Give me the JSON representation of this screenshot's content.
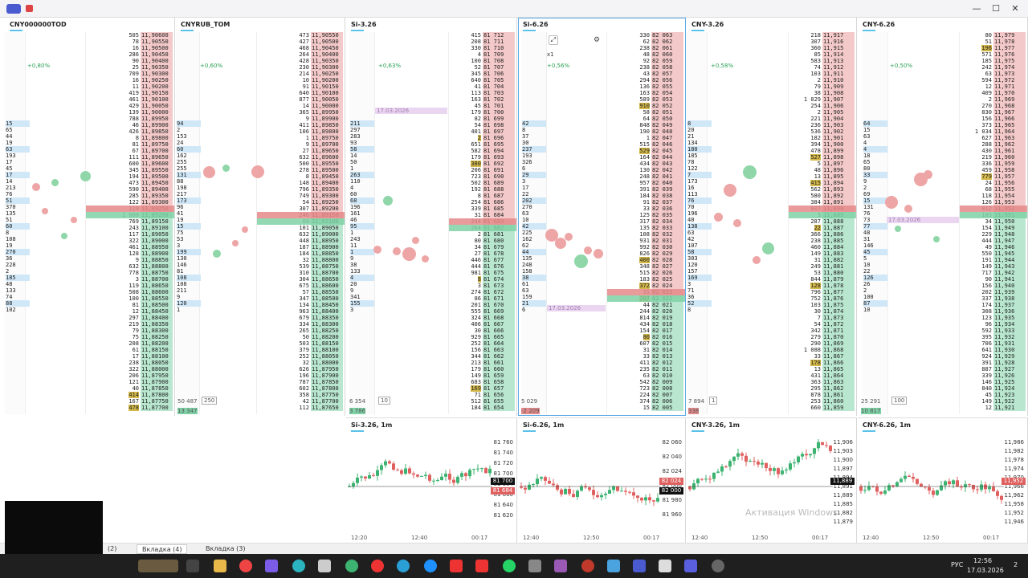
{
  "titlebar": {
    "minimize": "—",
    "maximize": "☐",
    "close": "✕"
  },
  "panels": [
    {
      "name": "CNY000000TOD",
      "pct": "+0,80%",
      "first_price": "11,90600",
      "footer_left": "",
      "footer_right": ""
    },
    {
      "name": "CNYRUB_TOM",
      "pct": "+0,60%",
      "first_price": "11,90550",
      "footer_left": "50 487",
      "footer_left2": "13 347",
      "footer_badge": "250",
      "time": "12:55"
    },
    {
      "name": "Si-3.26",
      "pct": "+0,63%",
      "first_price": "81 712",
      "footer_left": "6 354",
      "footer_left2": "3 786",
      "footer_badge": "10",
      "time": "12:55",
      "date_tag": "17.03.2026"
    },
    {
      "name": "Si-6.26",
      "pct": "+0,56%",
      "first_price": "82 063",
      "footer_left": "5 029",
      "footer_left2": "-2 209",
      "time": "12:55",
      "date_tag": "17.03.2026",
      "zoom": "x1"
    },
    {
      "name": "CNY-3.26",
      "pct": "+0,58%",
      "first_price": "11,917",
      "footer_left": "7 894",
      "footer_left2": "338",
      "footer_badge": "1",
      "time": "12:55"
    },
    {
      "name": "CNY-6.26",
      "pct": "+0,50%",
      "first_price": "11,979",
      "footer_left": "25 291",
      "footer_left2": "10 817",
      "footer_badge": "100",
      "time": "12:55",
      "date_tag": "17.03.2026"
    }
  ],
  "charts": [
    {
      "title": "Si-3.26, 1m",
      "prices": [
        "81 760",
        "81 740",
        "81 720",
        "81 700",
        "81 684",
        "81 660",
        "81 640",
        "81 620"
      ],
      "last": "81 700",
      "last2": "81 684",
      "times": [
        "12:20",
        "12:40",
        "00:17"
      ]
    },
    {
      "title": "Si-6.26, 1m",
      "prices": [
        "82 060",
        "82 040",
        "82 024",
        "82 000",
        "81 980",
        "81 960"
      ],
      "last": "82 024",
      "last2": "82 000",
      "times": [
        "12:40",
        "12:50",
        "00:17"
      ]
    },
    {
      "title": "CNY-3.26, 1m",
      "prices": [
        "11,906",
        "11,903",
        "11,900",
        "11,897",
        "11,894",
        "11,891",
        "11,889",
        "11,885",
        "11,882",
        "11,879"
      ],
      "last": "11,889",
      "times": [
        "12:40",
        "12:50",
        "00:17"
      ]
    },
    {
      "title": "CNY-6.26, 1m",
      "prices": [
        "11,986",
        "11,982",
        "11,978",
        "11,974",
        "11,970",
        "11,966",
        "11,962",
        "11,958",
        "11,952",
        "11,946"
      ],
      "last": "11,952",
      "times": [
        "12:40",
        "12:50",
        "00:17"
      ]
    }
  ],
  "tabs": [
    {
      "label": "(2)"
    },
    {
      "label": "Вкладка (4)"
    },
    {
      "label": "Вкладка (3)"
    }
  ],
  "watermark": "Активация Windows",
  "tray": {
    "lang": "РУС",
    "time": "12:56",
    "date": "17.03.2026",
    "notif": "2"
  },
  "colors": {
    "ask": "#f4c9c9",
    "bid": "#b8e6cf",
    "best_ask": "#e58a8a",
    "best_bid": "#7fd1a6",
    "highlight": "#d4b94a",
    "accent": "#5bc0eb"
  }
}
